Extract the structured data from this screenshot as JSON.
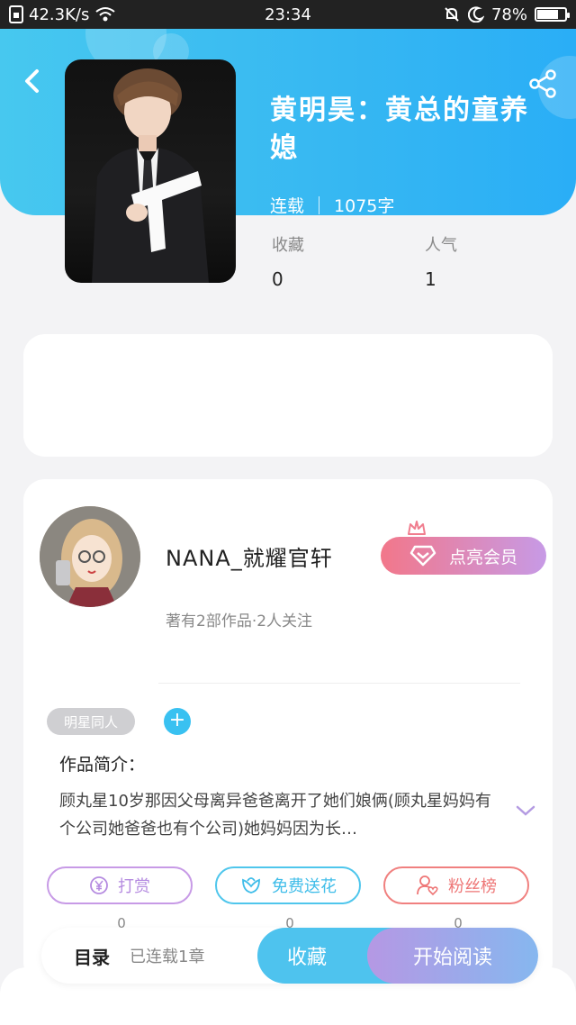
{
  "status_bar": {
    "net_speed": "42.3K/s",
    "time": "23:34",
    "battery_percent": "78%",
    "battery_level": 0.78
  },
  "book": {
    "title": "黄明昊：黄总的童养媳",
    "status": "连载",
    "word_count": "1075字"
  },
  "stats": [
    {
      "label": "收藏",
      "value": "0"
    },
    {
      "label": "人气",
      "value": "1"
    }
  ],
  "author": {
    "name": "NANA_就耀官轩",
    "summary": "著有2部作品·2人关注",
    "vip_label": "点亮会员"
  },
  "tags": [
    "明星同人"
  ],
  "intro": {
    "title": "作品简介：",
    "text": "顾丸星10岁那因父母离异爸爸离开了她们娘俩(顾丸星妈妈有个公司她爸爸也有个公司)她妈妈因为长…"
  },
  "actions": [
    {
      "label": "打赏",
      "count": "0",
      "color": "#c79ae6"
    },
    {
      "label": "免费送花",
      "count": "0",
      "color": "#4fc6ec"
    },
    {
      "label": "粉丝榜",
      "count": "0",
      "color": "#f0807f"
    }
  ],
  "bottom_bar": {
    "toc_label": "目录",
    "toc_sub": "已连载1章",
    "favorite_label": "收藏",
    "read_label": "开始阅读"
  },
  "colors": {
    "header": "#36b7f2",
    "accent_blue": "#39c1f1",
    "vip_gradient_start": "#f2778a",
    "vip_gradient_end": "#c79ae6"
  }
}
